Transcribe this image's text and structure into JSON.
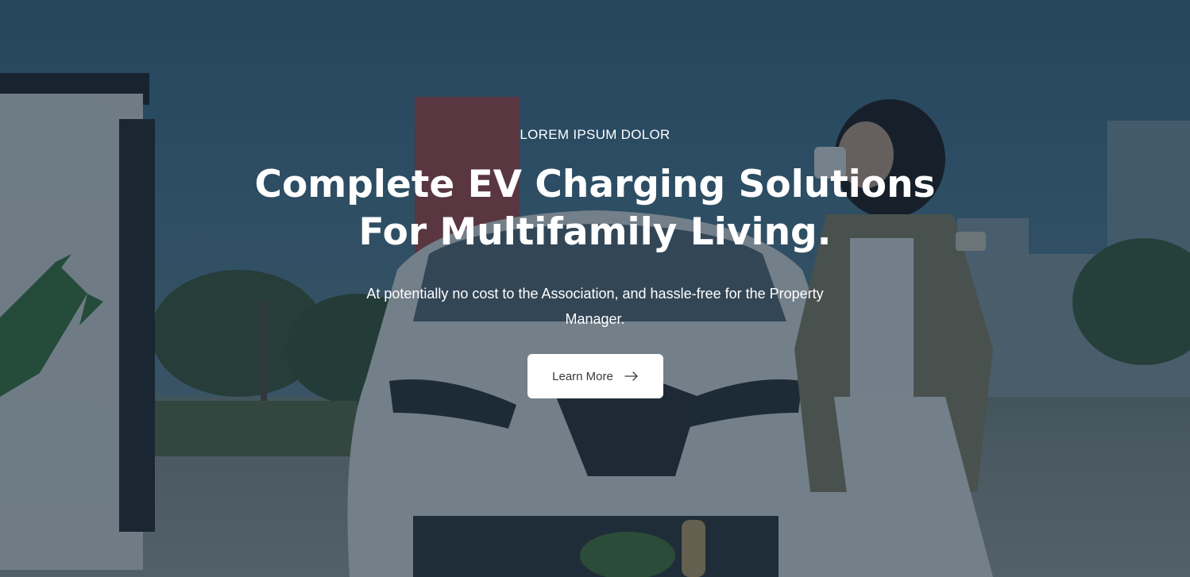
{
  "hero": {
    "eyebrow": "LOREM IPSUM DOLOR",
    "headline_line1": "Complete EV Charging Solutions",
    "headline_line2": "For Multifamily Living.",
    "subtext": "At potentially no cost to the Association, and hassle-free for the Property Manager.",
    "cta_label": "Learn More",
    "cta_icon": "arrow-right-icon"
  },
  "background": {
    "image": "electric-car-charging-station-woman-drinking-coffee",
    "overlay_color": "#122638",
    "charger_accent": "#3c7a3e"
  }
}
